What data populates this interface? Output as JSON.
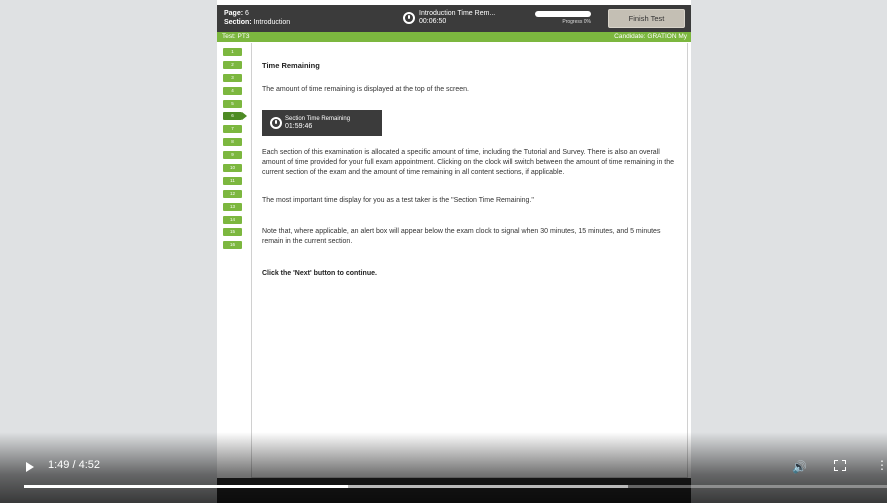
{
  "topbar": {
    "page_label": "Page:",
    "page_value": "6",
    "section_label": "Section:",
    "section_value": "Introduction",
    "timer_title": "Introduction Time Rem...",
    "timer_value": "00:06:50",
    "progress_label": "Progress 0%",
    "progress_fraction": 0.0,
    "finish_button": "Finish Test"
  },
  "greenbar": {
    "test_text": "Test: PT3",
    "candidate_text": "Candidate: GRATION My"
  },
  "nav": {
    "items": [
      "1",
      "2",
      "3",
      "4",
      "5",
      "6",
      "7",
      "8",
      "9",
      "10",
      "11",
      "12",
      "13",
      "14",
      "15",
      "16"
    ],
    "current": "6"
  },
  "content": {
    "heading": "Time Remaining",
    "intro": "The amount of time remaining is displayed at the top of the screen.",
    "clock_label": "Section Time Remaining",
    "clock_time": "01:59:46",
    "para1": "Each section of this examination is allocated a specific amount of time, including the Tutorial and Survey. There is also an overall amount of time provided for your full exam appointment. Clicking on the clock will switch between the amount of time remaining in the current section of the exam and the amount of time remaining in all content sections, if applicable.",
    "para2": "The most important time display for you as a test taker is the \"Section Time Remaining.\"",
    "para3": "Note that, where applicable, an alert box will appear below the exam clock to signal when 30 minutes, 15 minutes, and 5 minutes remain in the current section.",
    "cta": "Click the 'Next' button to continue."
  },
  "video": {
    "time_display": "1:49 / 4:52",
    "played_fraction": 0.375,
    "buffered_fraction": 0.7,
    "icons": [
      "play-icon",
      "volume-icon",
      "fullscreen-icon",
      "more-options-icon"
    ]
  },
  "colors": {
    "accent_green": "#7cb73f",
    "dark_bar": "#3b3b3b"
  }
}
